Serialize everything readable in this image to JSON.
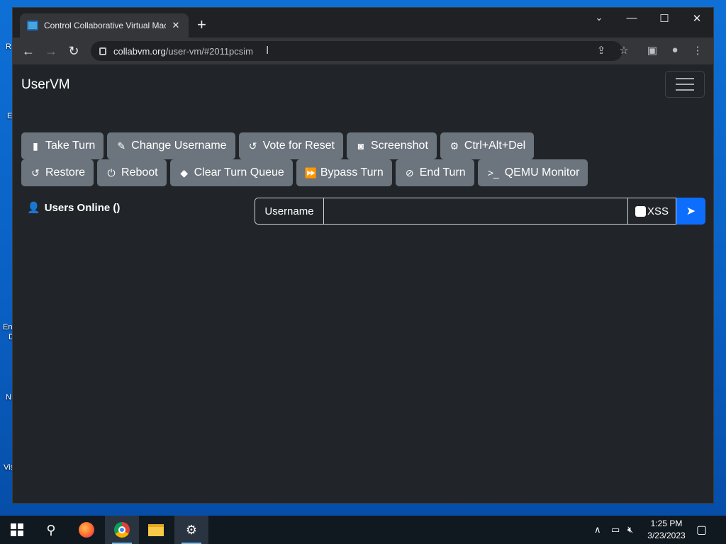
{
  "browser": {
    "tab_title": "Control Collaborative Virtual Machine",
    "new_tab_icon": "+",
    "url_host": "collabvm.org",
    "url_path": "/user-vm/#2011pcsim"
  },
  "app": {
    "brand": "UserVM",
    "row1": [
      {
        "icon": "mouse-icon",
        "glyph": "▮",
        "label": "Take Turn"
      },
      {
        "icon": "user-edit-icon",
        "glyph": "✎",
        "label": "Change Username"
      },
      {
        "icon": "rotate-left-icon",
        "glyph": "↺",
        "label": "Vote for Reset"
      },
      {
        "icon": "camera-icon",
        "glyph": "◙",
        "label": "Screenshot"
      },
      {
        "icon": "gear-icon",
        "glyph": "⚙",
        "label": "Ctrl+Alt+Del"
      }
    ],
    "row2": [
      {
        "icon": "rotate-left-icon",
        "glyph": "↺",
        "label": "Restore"
      },
      {
        "icon": "power-icon",
        "glyph": "⏻",
        "label": "Reboot"
      },
      {
        "icon": "eraser-icon",
        "glyph": "◆",
        "label": "Clear Turn Queue"
      },
      {
        "icon": "forward-icon",
        "glyph": "⏩",
        "label": "Bypass Turn"
      },
      {
        "icon": "ban-icon",
        "glyph": "⊘",
        "label": "End Turn"
      },
      {
        "icon": "terminal-icon",
        "glyph": ">_",
        "label": "QEMU Monitor"
      }
    ],
    "users_online": "Users Online ()",
    "chat": {
      "username_label": "Username",
      "input_value": "",
      "xss_label": "XSS"
    }
  },
  "taskbar": {
    "time": "1:25 PM",
    "date": "3/23/2023"
  },
  "desktop_labels": [
    "R",
    "E",
    "En",
    "D",
    "N",
    "Vis"
  ]
}
